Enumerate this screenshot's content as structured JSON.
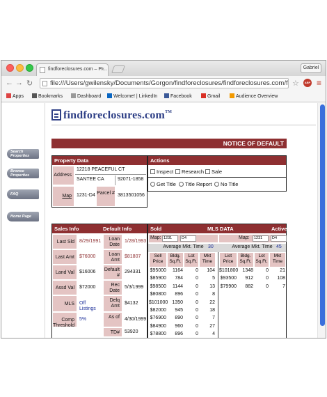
{
  "browser": {
    "tab_title": "findforeclosures.com – Pr...",
    "tab_close": "×",
    "user_button": "Gabriel",
    "url": "file:///Users/gwilensky/Documents/Gorgon/findforeclosures/findforeclosures.com/fore...",
    "abp_label": "ABP",
    "bookmarks": [
      {
        "label": "Apps",
        "icon": "apps-grid-icon",
        "color": "#d44"
      },
      {
        "label": "Bookmarks",
        "icon": "star-icon",
        "color": "#555"
      },
      {
        "label": "Dashboard",
        "icon": "page-icon",
        "color": "#999"
      },
      {
        "label": "Welcome! | LinkedIn",
        "icon": "linkedin-icon",
        "color": "#0a66c2"
      },
      {
        "label": "Facebook",
        "icon": "facebook-icon",
        "color": "#3b5998"
      },
      {
        "label": "Gmail",
        "icon": "gmail-icon",
        "color": "#d93025"
      },
      {
        "label": "Audience Overview",
        "icon": "analytics-icon",
        "color": "#f29900"
      }
    ]
  },
  "site": {
    "logo_text": "findforeclosures.com",
    "logo_tm": "TM",
    "side_nav": [
      "Search Properties",
      "Browse Properties",
      "FAQ",
      "Home Page"
    ],
    "banner": "NOTICE OF DEFAULT"
  },
  "property_data": {
    "header": "Property Data",
    "address_label": "Address",
    "street": "12218 PEACEFUL CT",
    "city": "SANTEE CA",
    "zip": "92071-1858",
    "map_label": "Map",
    "map_value": "1231-D4",
    "parcel_label": "Parcel #",
    "parcel_value": "3813501056"
  },
  "actions": {
    "header": "Actions",
    "checkboxes": [
      "Inspect",
      "Research",
      "Sale"
    ],
    "radios": [
      "Get Title",
      "Title Report",
      "No Title"
    ]
  },
  "sales_info": {
    "header_left": "Sales Info",
    "header_right": "Default Info",
    "rows": [
      {
        "label": "Last Sld",
        "value": "8/29/1991",
        "label2": "Loan Date",
        "value2": "1/28/1993"
      },
      {
        "label": "Last Amt",
        "value": "$76000",
        "label2": "Loan Amt",
        "value2": "$81807"
      },
      {
        "label": "Land Val",
        "value": "$16006",
        "label2": "Default #",
        "value2": "294331"
      },
      {
        "label": "Assd Val",
        "value": "$72000",
        "label2": "Rec Date",
        "value2": "5/3/1999"
      },
      {
        "label": "MLS",
        "value": "Off Listings",
        "label2": "Delq Amt",
        "value2": "$4132"
      },
      {
        "label": "Comp Threshold",
        "value": "5%",
        "label2": "As of",
        "value2": "4/30/1999"
      },
      {
        "label": "",
        "value": "",
        "label2": "TD#",
        "value2": "53920"
      }
    ]
  },
  "sold": {
    "header_left": "Sold",
    "header_mid": "MLS DATA",
    "map_label": "Map:",
    "map_a": "1231",
    "map_b": "D4",
    "avg_label": "Average Mkt. Time",
    "avg_value": "30",
    "columns": [
      "Sell Price",
      "Bldg. Sq.Ft.",
      "Lot Sq.Ft.",
      "Mkt Time"
    ],
    "rows": [
      [
        "$95000",
        "1164",
        "0",
        "104"
      ],
      [
        "$85900",
        "784",
        "0",
        "5"
      ],
      [
        "$98500",
        "1144",
        "0",
        "13"
      ],
      [
        "$80800",
        "896",
        "0",
        "8"
      ],
      [
        "$101000",
        "1350",
        "0",
        "22"
      ],
      [
        "$82000",
        "945",
        "0",
        "18"
      ],
      [
        "$76900",
        "890",
        "0",
        "7"
      ],
      [
        "$84900",
        "960",
        "0",
        "27"
      ],
      [
        "$78800",
        "896",
        "0",
        "4"
      ]
    ]
  },
  "active": {
    "header": "Active",
    "map_label": "Map:",
    "map_a": "1231",
    "map_b": "D4",
    "avg_label": "Average Mkt. Time",
    "avg_value": "45",
    "columns": [
      "List Price",
      "Bldg. Sq.Ft.",
      "Lot Sq.Ft.",
      "Mkt Time"
    ],
    "rows": [
      [
        "$101800",
        "1348",
        "0",
        "21"
      ],
      [
        "$93500",
        "912",
        "0",
        "108"
      ],
      [
        "$79900",
        "882",
        "0",
        "7"
      ]
    ]
  }
}
